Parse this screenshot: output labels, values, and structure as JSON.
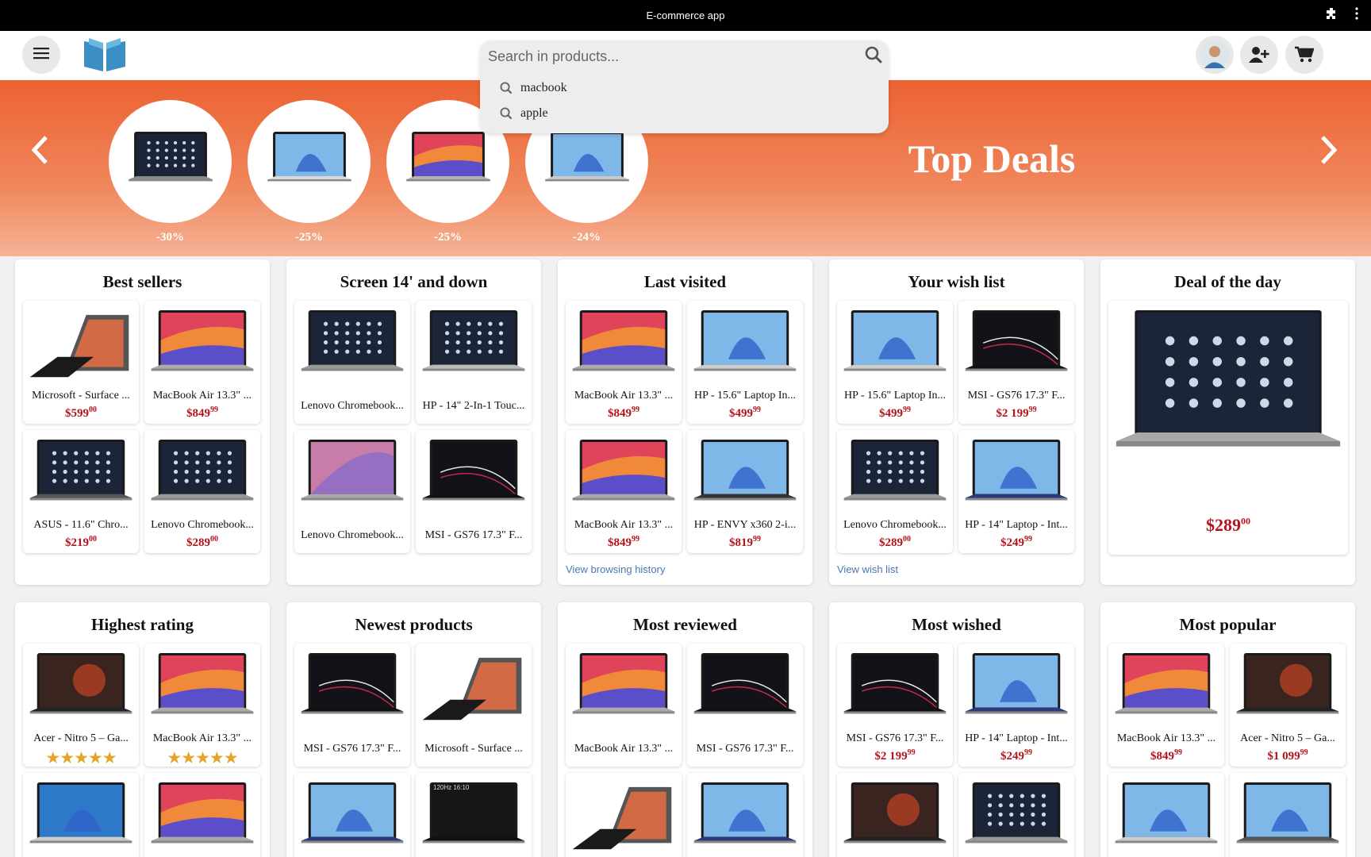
{
  "window": {
    "title": "E-commerce app"
  },
  "header": {
    "search_placeholder": "Search in products..."
  },
  "search_suggestions": [
    "macbook",
    "apple"
  ],
  "banner": {
    "title": "Top Deals",
    "deals": [
      {
        "discount": "-30%",
        "screen": "chrome",
        "body": "#8a8a8a"
      },
      {
        "discount": "-25%",
        "screen": "win",
        "body": "#d8d8d8"
      },
      {
        "discount": "-25%",
        "screen": "mac",
        "body": "#b0b0b0"
      },
      {
        "discount": "-24%",
        "screen": "win",
        "body": "#c8c8c8"
      }
    ]
  },
  "sections": [
    {
      "title": "Best sellers",
      "link": null,
      "cards": [
        {
          "name": "Microsoft - Surface ...",
          "price": "$599",
          "cents": "00",
          "screen": "surface",
          "body": "#222"
        },
        {
          "name": "MacBook Air 13.3\" ...",
          "price": "$849",
          "cents": "99",
          "screen": "mac",
          "body": "#aaa"
        },
        {
          "name": "ASUS - 11.6\" Chro...",
          "price": "$219",
          "cents": "00",
          "screen": "chrome",
          "body": "#555"
        },
        {
          "name": "Lenovo Chromebook...",
          "price": "$289",
          "cents": "00",
          "screen": "chrome",
          "body": "#999"
        }
      ]
    },
    {
      "title": "Screen 14' and down",
      "link": null,
      "cards": [
        {
          "name": "Lenovo Chromebook...",
          "price": null,
          "screen": "chrome",
          "body": "#999"
        },
        {
          "name": "HP - 14\" 2-In-1 Touc...",
          "price": null,
          "screen": "chrome",
          "body": "#bbb"
        },
        {
          "name": "Lenovo Chromebook...",
          "price": null,
          "screen": "lenovo",
          "body": "#aaa"
        },
        {
          "name": "MSI - GS76 17.3\" F...",
          "price": null,
          "screen": "msi",
          "body": "#111"
        }
      ]
    },
    {
      "title": "Last visited",
      "link": "View browsing history",
      "cards": [
        {
          "name": "MacBook Air 13.3\" ...",
          "price": "$849",
          "cents": "99",
          "screen": "mac",
          "body": "#aaa"
        },
        {
          "name": "HP - 15.6\" Laptop In...",
          "price": "$499",
          "cents": "99",
          "screen": "win",
          "body": "#ccc"
        },
        {
          "name": "MacBook Air 13.3\" ...",
          "price": "$849",
          "cents": "99",
          "screen": "mac",
          "body": "#aaa"
        },
        {
          "name": "HP - ENVY x360 2-i...",
          "price": "$819",
          "cents": "99",
          "screen": "win",
          "body": "#333"
        }
      ]
    },
    {
      "title": "Your wish list",
      "link": "View wish list",
      "cards": [
        {
          "name": "HP - 15.6\" Laptop In...",
          "price": "$499",
          "cents": "99",
          "screen": "win",
          "body": "#ccc"
        },
        {
          "name": "MSI - GS76 17.3\" F...",
          "price": "$2 199",
          "cents": "99",
          "screen": "msi",
          "body": "#111"
        },
        {
          "name": "Lenovo Chromebook...",
          "price": "$289",
          "cents": "00",
          "screen": "chrome",
          "body": "#999"
        },
        {
          "name": "HP - 14\" Laptop - Int...",
          "price": "$249",
          "cents": "99",
          "screen": "win",
          "body": "#2c3a7a"
        }
      ]
    },
    {
      "title": "Deal of the day",
      "deal_price": "$289",
      "deal_cents": "00"
    },
    {
      "title": "Highest rating",
      "link": null,
      "cards": [
        {
          "name": "Acer - Nitro 5 – Ga...",
          "stars": "★★★★★",
          "screen": "acer",
          "body": "#222"
        },
        {
          "name": "MacBook Air 13.3\" ...",
          "stars": "★★★★★",
          "screen": "mac",
          "body": "#aaa"
        },
        {
          "name": "",
          "screen": "win10",
          "body": "#ccc"
        },
        {
          "name": "",
          "screen": "mac",
          "body": "#aaa"
        }
      ]
    },
    {
      "title": "Newest products",
      "link": null,
      "cards": [
        {
          "name": "MSI - GS76 17.3\" F...",
          "price": null,
          "screen": "msi",
          "body": "#111"
        },
        {
          "name": "Microsoft - Surface ...",
          "price": null,
          "screen": "surface",
          "body": "#222"
        },
        {
          "name": "",
          "screen": "win",
          "body": "#2c3a7a"
        },
        {
          "name": "",
          "screen": "rog",
          "body": "#111",
          "tag": "120Hz 16:10"
        }
      ]
    },
    {
      "title": "Most reviewed",
      "link": null,
      "cards": [
        {
          "name": "MacBook Air 13.3\" ...",
          "price": null,
          "screen": "mac",
          "body": "#aaa"
        },
        {
          "name": "MSI - GS76 17.3\" F...",
          "price": null,
          "screen": "msi",
          "body": "#111"
        },
        {
          "name": "",
          "screen": "surface",
          "body": "#222"
        },
        {
          "name": "",
          "screen": "win",
          "body": "#2c3a7a"
        }
      ]
    },
    {
      "title": "Most wished",
      "link": null,
      "cards": [
        {
          "name": "MSI - GS76 17.3\" F...",
          "price": "$2 199",
          "cents": "99",
          "screen": "msi",
          "body": "#111"
        },
        {
          "name": "HP - 14\" Laptop - Int...",
          "price": "$249",
          "cents": "99",
          "screen": "win",
          "body": "#2c3a7a"
        },
        {
          "name": "",
          "screen": "acer",
          "body": "#222"
        },
        {
          "name": "",
          "screen": "chrome",
          "body": "#999"
        }
      ]
    },
    {
      "title": "Most popular",
      "link": null,
      "cards": [
        {
          "name": "MacBook Air 13.3\" ...",
          "price": "$849",
          "cents": "99",
          "screen": "mac",
          "body": "#aaa"
        },
        {
          "name": "Acer - Nitro 5 – Ga...",
          "price": "$1 099",
          "cents": "99",
          "screen": "acer",
          "body": "#222"
        },
        {
          "name": "",
          "screen": "win",
          "body": "#ccc"
        },
        {
          "name": "",
          "screen": "win",
          "body": "#555"
        }
      ]
    }
  ],
  "colors": {
    "accent": "#ec6232",
    "price": "#b5121b",
    "link": "#4a78b0",
    "stars": "#e4a42a"
  }
}
